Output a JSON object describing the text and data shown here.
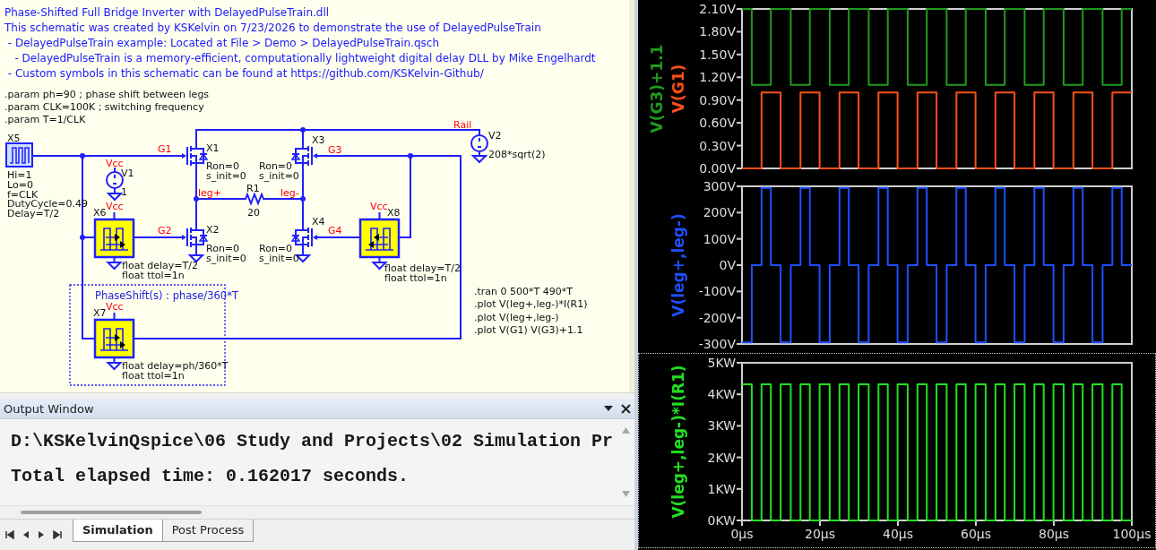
{
  "schematic": {
    "comments": [
      "Phase-Shifted Full Bridge Inverter with DelayedPulseTrain.dll",
      "This schematic was created by KSKelvin on 7/23/2026 to demonstrate the use of DelayedPulseTrain",
      " - DelayedPulseTrain example: Located at File > Demo > DelayedPulseTrain.qsch",
      "   - DelayedPulseTrain is a memory-efficient, computationally lightweight digital delay DLL by Mike Engelhardt",
      " - Custom symbols in this schematic can be found at https://github.com/KSKelvin-Github/"
    ],
    "params": [
      ".param ph=90 ; phase shift between legs",
      ".param CLK=100K ; switching frequency",
      ".param T=1/CLK"
    ],
    "components": [
      {
        "ref": "X5",
        "kind": "pulse",
        "attrs": [
          "Hi=1",
          "Lo=0",
          "f=CLK",
          "DutyCycle=0.49",
          "Delay=T/2"
        ]
      },
      {
        "ref": "V1",
        "kind": "vsource",
        "attrs": [
          "1"
        ]
      },
      {
        "ref": "X1",
        "kind": "switch",
        "attrs": [
          "Ron=0",
          "s_init=0"
        ]
      },
      {
        "ref": "X3",
        "kind": "switch",
        "attrs": [
          "Ron=0",
          "s_init=0"
        ]
      },
      {
        "ref": "X2",
        "kind": "switch",
        "attrs": [
          "Ron=0",
          "s_init=0"
        ]
      },
      {
        "ref": "X4",
        "kind": "switch",
        "attrs": [
          "Ron=0",
          "s_init=0"
        ]
      },
      {
        "ref": "R1",
        "kind": "resistor",
        "attrs": [
          "20"
        ]
      },
      {
        "ref": "V2",
        "kind": "vsource",
        "attrs": [
          "208*sqrt(2)"
        ]
      },
      {
        "ref": "X6",
        "kind": "delay",
        "attrs": [
          "float delay=T/2",
          "float ttol=1n"
        ]
      },
      {
        "ref": "X7",
        "kind": "delay",
        "attrs": [
          "float delay=ph/360*T",
          "float ttol=1n"
        ]
      },
      {
        "ref": "X8",
        "kind": "delay",
        "attrs": [
          "float delay=T/2",
          "float ttol=1n"
        ]
      }
    ],
    "net_labels": [
      "G1",
      "G2",
      "G3",
      "G4",
      "leg+",
      "leg-",
      "Rail",
      "Vcc",
      "Vcc",
      "Vcc",
      "Vcc"
    ],
    "group_box": {
      "label": "PhaseShift(s) : phase/360*T"
    },
    "directives": [
      ".tran 0 500*T 490*T",
      ".plot V(leg+,leg-)*I(R1)",
      ".plot V(leg+,leg-)",
      ".plot V(G1) V(G3)+1.1"
    ]
  },
  "output_window": {
    "title": "Output Window",
    "lines": [
      "D:\\KSKelvinQspice\\06 Study and Projects\\02 Simulation Pr",
      "Total elapsed time: 0.162017 seconds."
    ]
  },
  "tabs": [
    {
      "label": "Simulation",
      "selected": true
    },
    {
      "label": "Post Process",
      "selected": false
    }
  ],
  "plots": [
    {
      "chart_data": {
        "type": "line",
        "xlim": [
          0,
          100
        ],
        "ylim": [
          0,
          2.1
        ],
        "yticks": [
          {
            "value": 0,
            "label": "0.00V"
          },
          {
            "value": 0.3,
            "label": "0.30V"
          },
          {
            "value": 0.6,
            "label": "0.60V"
          },
          {
            "value": 0.9,
            "label": "0.90V"
          },
          {
            "value": 1.2,
            "label": "1.20V"
          },
          {
            "value": 1.5,
            "label": "1.50V"
          },
          {
            "value": 1.8,
            "label": "1.80V"
          },
          {
            "value": 2.1,
            "label": "2.10V"
          }
        ],
        "x": [
          0,
          2.5,
          2.5,
          5,
          5,
          7.4,
          7.4,
          9.9,
          9.9,
          12.5,
          12.5,
          15,
          15,
          17.4,
          17.4,
          19.9,
          19.9,
          22.5,
          22.5,
          25,
          25,
          27.4,
          27.4,
          29.9,
          29.9,
          32.5,
          32.5,
          35,
          35,
          37.4,
          37.4,
          39.9,
          39.9,
          42.5,
          42.5,
          45,
          45,
          47.4,
          47.4,
          49.9,
          49.9,
          52.5,
          52.5,
          55,
          55,
          57.4,
          57.4,
          59.9,
          59.9,
          62.5,
          62.5,
          65,
          65,
          67.4,
          67.4,
          69.9,
          69.9,
          72.5,
          72.5,
          75,
          75,
          77.4,
          77.4,
          79.9,
          79.9,
          82.5,
          82.5,
          85,
          85,
          87.4,
          87.4,
          89.9,
          89.9,
          92.5,
          92.5,
          95,
          95,
          97.4,
          97.4,
          100
        ],
        "series": [
          {
            "name": "V(G3)+1.1",
            "color": "#1f9a1f",
            "values": [
              2.1,
              2.1,
              1.1,
              1.1,
              1.1,
              1.1,
              2.1,
              2.1,
              2.1,
              2.1,
              1.1,
              1.1,
              1.1,
              1.1,
              2.1,
              2.1,
              2.1,
              2.1,
              1.1,
              1.1,
              1.1,
              1.1,
              2.1,
              2.1,
              2.1,
              2.1,
              1.1,
              1.1,
              1.1,
              1.1,
              2.1,
              2.1,
              2.1,
              2.1,
              1.1,
              1.1,
              1.1,
              1.1,
              2.1,
              2.1,
              2.1,
              2.1,
              1.1,
              1.1,
              1.1,
              1.1,
              2.1,
              2.1,
              2.1,
              2.1,
              1.1,
              1.1,
              1.1,
              1.1,
              2.1,
              2.1,
              2.1,
              2.1,
              1.1,
              1.1,
              1.1,
              1.1,
              2.1,
              2.1,
              2.1,
              2.1,
              1.1,
              1.1,
              1.1,
              1.1,
              2.1,
              2.1,
              2.1,
              2.1,
              1.1,
              1.1,
              1.1,
              1.1,
              2.1,
              2.1
            ]
          },
          {
            "name": "V(G1)",
            "color": "#ff4f1a",
            "values": [
              0,
              0,
              0,
              0,
              1,
              1,
              1,
              1,
              0,
              0,
              0,
              0,
              1,
              1,
              1,
              1,
              0,
              0,
              0,
              0,
              1,
              1,
              1,
              1,
              0,
              0,
              0,
              0,
              1,
              1,
              1,
              1,
              0,
              0,
              0,
              0,
              1,
              1,
              1,
              1,
              0,
              0,
              0,
              0,
              1,
              1,
              1,
              1,
              0,
              0,
              0,
              0,
              1,
              1,
              1,
              1,
              0,
              0,
              0,
              0,
              1,
              1,
              1,
              1,
              0,
              0,
              0,
              0,
              1,
              1,
              1,
              1,
              0,
              0,
              0,
              0,
              1,
              1,
              1,
              1
            ]
          }
        ]
      }
    },
    {
      "chart_data": {
        "type": "line",
        "xlim": [
          0,
          100
        ],
        "ylim": [
          -300,
          300
        ],
        "yticks": [
          {
            "value": -300,
            "label": "-300V"
          },
          {
            "value": -200,
            "label": "-200V"
          },
          {
            "value": -100,
            "label": "-100V"
          },
          {
            "value": 0,
            "label": "0V"
          },
          {
            "value": 100,
            "label": "100V"
          },
          {
            "value": 200,
            "label": "200V"
          },
          {
            "value": 300,
            "label": "300V"
          }
        ],
        "x": [
          0,
          2.5,
          2.5,
          5,
          5,
          7.4,
          7.4,
          9.9,
          9.9,
          12.5,
          12.5,
          15,
          15,
          17.4,
          17.4,
          19.9,
          19.9,
          22.5,
          22.5,
          25,
          25,
          27.4,
          27.4,
          29.9,
          29.9,
          32.5,
          32.5,
          35,
          35,
          37.4,
          37.4,
          39.9,
          39.9,
          42.5,
          42.5,
          45,
          45,
          47.4,
          47.4,
          49.9,
          49.9,
          52.5,
          52.5,
          55,
          55,
          57.4,
          57.4,
          59.9,
          59.9,
          62.5,
          62.5,
          65,
          65,
          67.4,
          67.4,
          69.9,
          69.9,
          72.5,
          72.5,
          75,
          75,
          77.4,
          77.4,
          79.9,
          79.9,
          82.5,
          82.5,
          85,
          85,
          87.4,
          87.4,
          89.9,
          89.9,
          92.5,
          92.5,
          95,
          95,
          97.4,
          97.4,
          100
        ],
        "series": [
          {
            "name": "V(leg+,leg-)",
            "color": "#1f4fff",
            "values": [
              -294,
              -294,
              0,
              0,
              294,
              294,
              0,
              0,
              -294,
              -294,
              0,
              0,
              294,
              294,
              0,
              0,
              -294,
              -294,
              0,
              0,
              294,
              294,
              0,
              0,
              -294,
              -294,
              0,
              0,
              294,
              294,
              0,
              0,
              -294,
              -294,
              0,
              0,
              294,
              294,
              0,
              0,
              -294,
              -294,
              0,
              0,
              294,
              294,
              0,
              0,
              -294,
              -294,
              0,
              0,
              294,
              294,
              0,
              0,
              -294,
              -294,
              0,
              0,
              294,
              294,
              0,
              0,
              -294,
              -294,
              0,
              0,
              294,
              294,
              0,
              0,
              -294,
              -294,
              0,
              0,
              294,
              294,
              0,
              0
            ]
          }
        ]
      }
    },
    {
      "chart_data": {
        "type": "line",
        "xlim": [
          0,
          100
        ],
        "ylim": [
          0,
          5
        ],
        "yticks": [
          {
            "value": 0,
            "label": "0KW"
          },
          {
            "value": 1,
            "label": "1KW"
          },
          {
            "value": 2,
            "label": "2KW"
          },
          {
            "value": 3,
            "label": "3KW"
          },
          {
            "value": 4,
            "label": "4KW"
          },
          {
            "value": 5,
            "label": "5KW"
          }
        ],
        "xticks": [
          {
            "value": 0,
            "label": "0µs"
          },
          {
            "value": 20,
            "label": "20µs"
          },
          {
            "value": 40,
            "label": "40µs"
          },
          {
            "value": 60,
            "label": "60µs"
          },
          {
            "value": 80,
            "label": "80µs"
          },
          {
            "value": 100,
            "label": "100µs"
          }
        ],
        "x": [
          0,
          2.5,
          2.5,
          5,
          5,
          7.4,
          7.4,
          9.9,
          9.9,
          12.5,
          12.5,
          15,
          15,
          17.4,
          17.4,
          19.9,
          19.9,
          22.5,
          22.5,
          25,
          25,
          27.4,
          27.4,
          29.9,
          29.9,
          32.5,
          32.5,
          35,
          35,
          37.4,
          37.4,
          39.9,
          39.9,
          42.5,
          42.5,
          45,
          45,
          47.4,
          47.4,
          49.9,
          49.9,
          52.5,
          52.5,
          55,
          55,
          57.4,
          57.4,
          59.9,
          59.9,
          62.5,
          62.5,
          65,
          65,
          67.4,
          67.4,
          69.9,
          69.9,
          72.5,
          72.5,
          75,
          75,
          77.4,
          77.4,
          79.9,
          79.9,
          82.5,
          82.5,
          85,
          85,
          87.4,
          87.4,
          89.9,
          89.9,
          92.5,
          92.5,
          95,
          95,
          97.4,
          97.4,
          100
        ],
        "series": [
          {
            "name": "V(leg+,leg-)*I(R1)",
            "color": "#22e022",
            "values": [
              4.32,
              4.32,
              0,
              0,
              4.32,
              4.32,
              0,
              0,
              4.32,
              4.32,
              0,
              0,
              4.32,
              4.32,
              0,
              0,
              4.32,
              4.32,
              0,
              0,
              4.32,
              4.32,
              0,
              0,
              4.32,
              4.32,
              0,
              0,
              4.32,
              4.32,
              0,
              0,
              4.32,
              4.32,
              0,
              0,
              4.32,
              4.32,
              0,
              0,
              4.32,
              4.32,
              0,
              0,
              4.32,
              4.32,
              0,
              0,
              4.32,
              4.32,
              0,
              0,
              4.32,
              4.32,
              0,
              0,
              4.32,
              4.32,
              0,
              0,
              4.32,
              4.32,
              0,
              0,
              4.32,
              4.32,
              0,
              0,
              4.32,
              4.32,
              0,
              0,
              4.32,
              4.32,
              0,
              0,
              4.32,
              4.32,
              0,
              0
            ]
          }
        ]
      }
    }
  ]
}
